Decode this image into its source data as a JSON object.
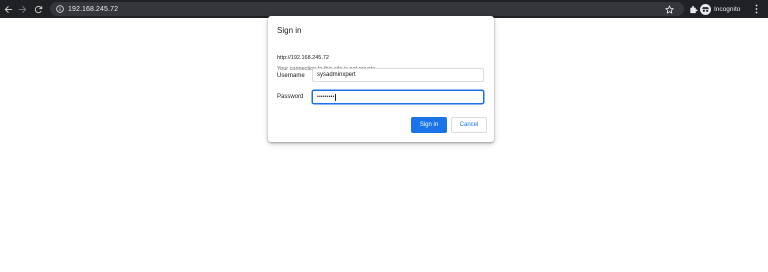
{
  "browser": {
    "back_icon": "arrow-left-icon",
    "forward_icon": "arrow-right-icon",
    "reload_icon": "reload-icon",
    "info_icon": "info-icon",
    "url": "192.168.245.72",
    "bookmark_icon": "star-icon",
    "extensions_icon": "puzzle-icon",
    "profile_label": "Incognito",
    "menu_icon": "kebab-menu-icon",
    "toolbar_color": "#202124",
    "omnibox_color": "#35363a"
  },
  "dialog": {
    "title": "Sign in",
    "origin": "http://192.168.245.72",
    "warning": "Your connection to this site is not private",
    "username_label": "Username",
    "username_value": "sysadminxpert",
    "password_label": "Password",
    "password_value": "•••••••••",
    "sign_in_label": "Sign in",
    "cancel_label": "Cancel",
    "accent_color": "#1a73e8"
  }
}
